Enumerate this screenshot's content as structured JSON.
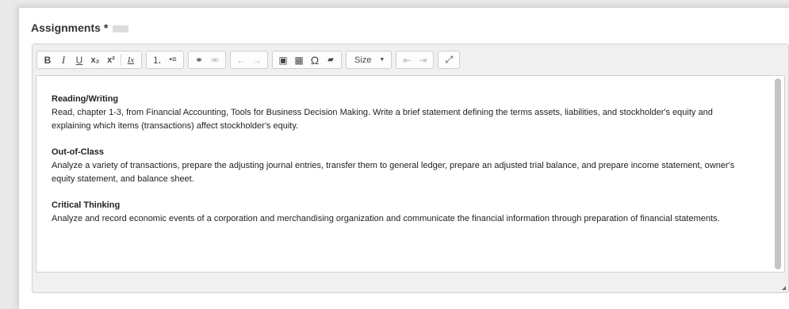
{
  "field": {
    "label": "Assignments",
    "required_marker": "*"
  },
  "toolbar": {
    "bold": "B",
    "italic": "I",
    "underline": "U",
    "subscript": "x₂",
    "superscript": "x²",
    "remove_format": "Ix",
    "numbered_list": "⒈",
    "bulleted_list": "•≡",
    "link": "⚭",
    "unlink": "⚮",
    "undo": "←",
    "redo": "→",
    "image": "▣",
    "table": "▦",
    "special_char": "Ω",
    "folder": "▰",
    "size_label": "Size",
    "size_caret": "▼",
    "outdent": "⇤",
    "indent": "⇥",
    "maximize": "⤢"
  },
  "content": {
    "sections": [
      {
        "title": "Reading/Writing",
        "body": "Read, chapter 1-3, from Financial Accounting, Tools for Business Decision Making. Write a brief statement defining the terms assets, liabilities, and stockholder's equity and explaining which items (transactions) affect stockholder's equity."
      },
      {
        "title": "Out-of-Class",
        "body": "Analyze a variety of transactions, prepare the adjusting journal entries, transfer them to general ledger, prepare an adjusted trial balance, and prepare income statement, owner's equity statement, and balance sheet."
      },
      {
        "title": "Critical Thinking",
        "body": "Analyze and record economic events of a corporation and merchandising organization and communicate the financial information through preparation of financial statements."
      }
    ]
  },
  "icons": [
    "dots-icon",
    "bold-icon",
    "italic-icon",
    "underline-icon",
    "subscript-icon",
    "superscript-icon",
    "remove-format-icon",
    "numbered-list-icon",
    "bulleted-list-icon",
    "link-icon",
    "unlink-icon",
    "undo-icon",
    "redo-icon",
    "image-icon",
    "table-icon",
    "omega-icon",
    "folder-icon",
    "caret-down-icon",
    "outdent-icon",
    "indent-icon",
    "maximize-icon",
    "resize-grip-icon"
  ]
}
